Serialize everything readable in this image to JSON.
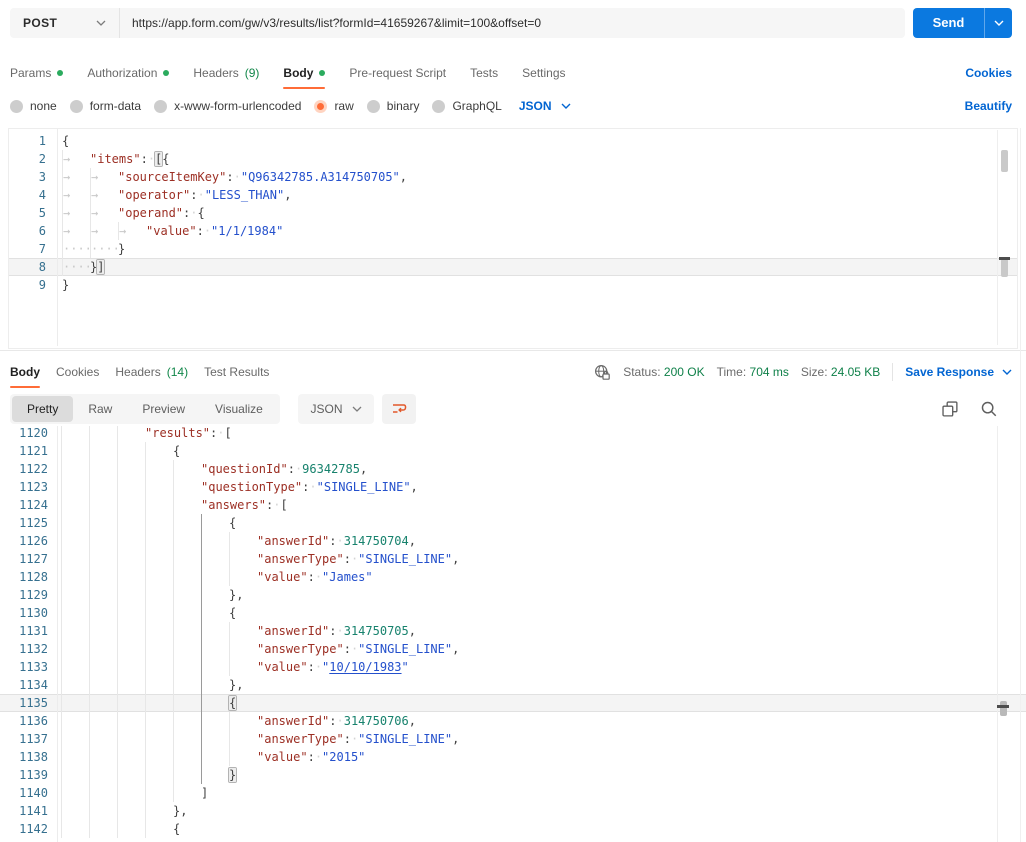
{
  "colors": {
    "accent_orange": "#ff6c37",
    "link_blue": "#0265d2",
    "send_blue": "#0b79e0",
    "success_green": "#0f8049",
    "dot_green": "#2bab5e",
    "key_red": "#9c2f24",
    "string_blue": "#2450cc",
    "number_teal": "#17826d",
    "line_number_blue": "#36708f"
  },
  "request_bar": {
    "method": "POST",
    "url": "https://app.form.com/gw/v3/results/list?formId=41659267&limit=100&offset=0",
    "send_label": "Send"
  },
  "request_tabs": {
    "params": "Params",
    "authorization": "Authorization",
    "headers": "Headers",
    "headers_badge": "(9)",
    "body": "Body",
    "pre_request": "Pre-request Script",
    "tests": "Tests",
    "settings": "Settings",
    "cookies_link": "Cookies"
  },
  "body_type_bar": {
    "none": "none",
    "form_data": "form-data",
    "urlencoded": "x-www-form-urlencoded",
    "raw": "raw",
    "binary": "binary",
    "graphql": "GraphQL",
    "selected": "raw",
    "language": "JSON",
    "beautify_link": "Beautify"
  },
  "request_editor": {
    "lines": [
      {
        "n": 1,
        "i": 0,
        "t": [
          [
            "p",
            "{"
          ]
        ]
      },
      {
        "n": 2,
        "i": 1,
        "ws": "a",
        "t": [
          [
            "k",
            "\"items\""
          ],
          [
            "p",
            ":"
          ],
          [
            "w"
          ],
          [
            "b",
            "["
          ],
          [
            "p",
            "{"
          ]
        ]
      },
      {
        "n": 3,
        "i": 2,
        "ws": "a",
        "t": [
          [
            "k",
            "\"sourceItemKey\""
          ],
          [
            "p",
            ":"
          ],
          [
            "w"
          ],
          [
            "s",
            "\"Q96342785.A314750705\""
          ],
          [
            "p",
            ","
          ]
        ]
      },
      {
        "n": 4,
        "i": 2,
        "ws": "a",
        "t": [
          [
            "k",
            "\"operator\""
          ],
          [
            "p",
            ":"
          ],
          [
            "w"
          ],
          [
            "s",
            "\"LESS_THAN\""
          ],
          [
            "p",
            ","
          ]
        ]
      },
      {
        "n": 5,
        "i": 2,
        "ws": "a",
        "t": [
          [
            "k",
            "\"operand\""
          ],
          [
            "p",
            ":"
          ],
          [
            "w"
          ],
          [
            "p",
            "{"
          ]
        ]
      },
      {
        "n": 6,
        "i": 3,
        "ws": "a",
        "t": [
          [
            "k",
            "\"value\""
          ],
          [
            "p",
            ":"
          ],
          [
            "w"
          ],
          [
            "s",
            "\"1/1/1984\""
          ]
        ]
      },
      {
        "n": 7,
        "i": 2,
        "ws": "d",
        "t": [
          [
            "p",
            "}"
          ]
        ]
      },
      {
        "n": 8,
        "i": 1,
        "ws": "d",
        "active": true,
        "t": [
          [
            "p",
            "}"
          ],
          [
            "b",
            "]"
          ]
        ]
      },
      {
        "n": 9,
        "i": 0,
        "t": [
          [
            "p",
            "}"
          ]
        ]
      }
    ]
  },
  "response_section": {
    "tabs": {
      "body": "Body",
      "cookies": "Cookies",
      "headers": "Headers",
      "headers_badge": "(14)",
      "test_results": "Test Results"
    },
    "meta": {
      "status_label": "Status:",
      "status_value": "200 OK",
      "time_label": "Time:",
      "time_value": "704 ms",
      "size_label": "Size:",
      "size_value": "24.05 KB",
      "save_label": "Save Response"
    },
    "toolbar": {
      "views": [
        "Pretty",
        "Raw",
        "Preview",
        "Visualize"
      ],
      "active_view": "Pretty",
      "language": "JSON"
    },
    "editor": {
      "scope": {
        "unit": 5,
        "from": 1125,
        "to": 1139
      },
      "lines": [
        {
          "n": 1120,
          "i": 3,
          "t": [
            [
              "k",
              "\"results\""
            ],
            [
              "p",
              ":"
            ],
            [
              "w"
            ],
            [
              "p",
              "["
            ]
          ]
        },
        {
          "n": 1121,
          "i": 4,
          "t": [
            [
              "p",
              "{"
            ]
          ]
        },
        {
          "n": 1122,
          "i": 5,
          "t": [
            [
              "k",
              "\"questionId\""
            ],
            [
              "p",
              ":"
            ],
            [
              "w"
            ],
            [
              "n",
              "96342785"
            ],
            [
              "p",
              ","
            ]
          ]
        },
        {
          "n": 1123,
          "i": 5,
          "t": [
            [
              "k",
              "\"questionType\""
            ],
            [
              "p",
              ":"
            ],
            [
              "w"
            ],
            [
              "s",
              "\"SINGLE_LINE\""
            ],
            [
              "p",
              ","
            ]
          ]
        },
        {
          "n": 1124,
          "i": 5,
          "t": [
            [
              "k",
              "\"answers\""
            ],
            [
              "p",
              ":"
            ],
            [
              "w"
            ],
            [
              "p",
              "["
            ]
          ]
        },
        {
          "n": 1125,
          "i": 6,
          "t": [
            [
              "p",
              "{"
            ]
          ]
        },
        {
          "n": 1126,
          "i": 7,
          "t": [
            [
              "k",
              "\"answerId\""
            ],
            [
              "p",
              ":"
            ],
            [
              "w"
            ],
            [
              "n",
              "314750704"
            ],
            [
              "p",
              ","
            ]
          ]
        },
        {
          "n": 1127,
          "i": 7,
          "t": [
            [
              "k",
              "\"answerType\""
            ],
            [
              "p",
              ":"
            ],
            [
              "w"
            ],
            [
              "s",
              "\"SINGLE_LINE\""
            ],
            [
              "p",
              ","
            ]
          ]
        },
        {
          "n": 1128,
          "i": 7,
          "t": [
            [
              "k",
              "\"value\""
            ],
            [
              "p",
              ":"
            ],
            [
              "w"
            ],
            [
              "s",
              "\"James\""
            ]
          ]
        },
        {
          "n": 1129,
          "i": 6,
          "t": [
            [
              "p",
              "},"
            ]
          ]
        },
        {
          "n": 1130,
          "i": 6,
          "t": [
            [
              "p",
              "{"
            ]
          ]
        },
        {
          "n": 1131,
          "i": 7,
          "t": [
            [
              "k",
              "\"answerId\""
            ],
            [
              "p",
              ":"
            ],
            [
              "w"
            ],
            [
              "n",
              "314750705"
            ],
            [
              "p",
              ","
            ]
          ]
        },
        {
          "n": 1132,
          "i": 7,
          "t": [
            [
              "k",
              "\"answerType\""
            ],
            [
              "p",
              ":"
            ],
            [
              "w"
            ],
            [
              "s",
              "\"SINGLE_LINE\""
            ],
            [
              "p",
              ","
            ]
          ]
        },
        {
          "n": 1133,
          "i": 7,
          "t": [
            [
              "k",
              "\"value\""
            ],
            [
              "p",
              ":"
            ],
            [
              "w"
            ],
            [
              "s",
              "\""
            ],
            [
              "su",
              "10/10/1983"
            ],
            [
              "s",
              "\""
            ]
          ]
        },
        {
          "n": 1134,
          "i": 6,
          "t": [
            [
              "p",
              "},"
            ]
          ]
        },
        {
          "n": 1135,
          "i": 6,
          "active": true,
          "t": [
            [
              "b",
              "{"
            ]
          ]
        },
        {
          "n": 1136,
          "i": 7,
          "t": [
            [
              "k",
              "\"answerId\""
            ],
            [
              "p",
              ":"
            ],
            [
              "w"
            ],
            [
              "n",
              "314750706"
            ],
            [
              "p",
              ","
            ]
          ]
        },
        {
          "n": 1137,
          "i": 7,
          "t": [
            [
              "k",
              "\"answerType\""
            ],
            [
              "p",
              ":"
            ],
            [
              "w"
            ],
            [
              "s",
              "\"SINGLE_LINE\""
            ],
            [
              "p",
              ","
            ]
          ]
        },
        {
          "n": 1138,
          "i": 7,
          "t": [
            [
              "k",
              "\"value\""
            ],
            [
              "p",
              ":"
            ],
            [
              "w"
            ],
            [
              "s",
              "\"2015\""
            ]
          ]
        },
        {
          "n": 1139,
          "i": 6,
          "t": [
            [
              "b",
              "}"
            ]
          ]
        },
        {
          "n": 1140,
          "i": 5,
          "t": [
            [
              "p",
              "]"
            ]
          ]
        },
        {
          "n": 1141,
          "i": 4,
          "t": [
            [
              "p",
              "},"
            ]
          ]
        },
        {
          "n": 1142,
          "i": 4,
          "t": [
            [
              "p",
              "{"
            ]
          ]
        }
      ]
    }
  }
}
